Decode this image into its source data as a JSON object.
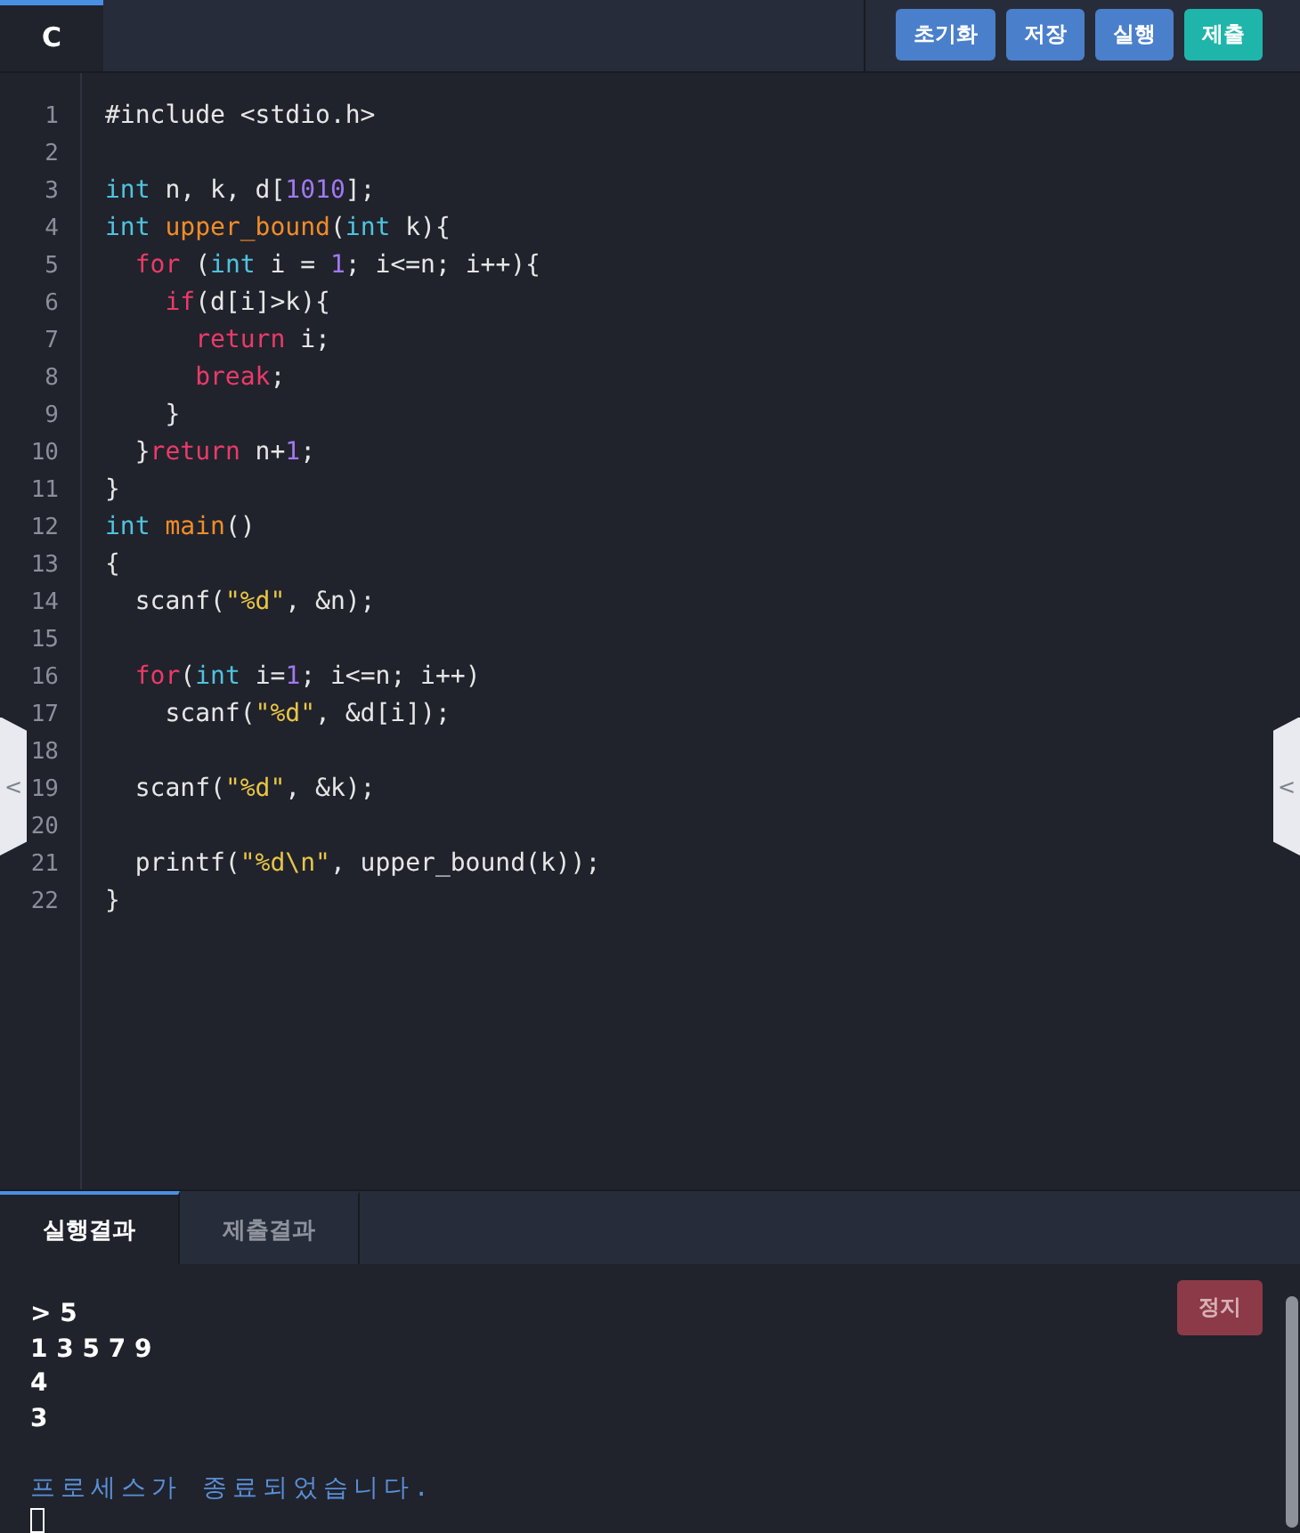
{
  "language_tab": {
    "label": "C",
    "selected": true
  },
  "toolbar": {
    "buttons": [
      {
        "label": "초기화",
        "kind": "primary"
      },
      {
        "label": "저장",
        "kind": "primary"
      },
      {
        "label": "실행",
        "kind": "primary"
      },
      {
        "label": "제출",
        "kind": "submit"
      }
    ]
  },
  "editor": {
    "lines": [
      {
        "number": "1",
        "tokens": [
          {
            "text": "#include <stdio.h>",
            "kind": "plain"
          }
        ]
      },
      {
        "number": "2"
      },
      {
        "number": "3",
        "tokens": [
          {
            "text": "int",
            "kind": "type"
          },
          {
            "text": " n, k, d[",
            "kind": "plain"
          },
          {
            "text": "1010",
            "kind": "number"
          },
          {
            "text": "];",
            "kind": "plain"
          }
        ]
      },
      {
        "number": "4",
        "tokens": [
          {
            "text": "int",
            "kind": "type"
          },
          {
            "text": " upper_bound",
            "kind": "function"
          },
          {
            "text": "(",
            "kind": "plain"
          },
          {
            "text": "int",
            "kind": "type"
          },
          {
            "text": " k){",
            "kind": "plain"
          }
        ]
      },
      {
        "number": "5",
        "tokens": [
          {
            "text": "  for",
            "kind": "keyword"
          },
          {
            "text": " (",
            "kind": "plain"
          },
          {
            "text": "int",
            "kind": "type"
          },
          {
            "text": " i = ",
            "kind": "plain"
          },
          {
            "text": "1",
            "kind": "number"
          },
          {
            "text": "; i<=n; i++){",
            "kind": "plain"
          }
        ]
      },
      {
        "number": "6",
        "tokens": [
          {
            "text": "    if",
            "kind": "keyword"
          },
          {
            "text": "(d[i]>k){",
            "kind": "plain"
          }
        ]
      },
      {
        "number": "7",
        "tokens": [
          {
            "text": "      return",
            "kind": "keyword"
          },
          {
            "text": " i;",
            "kind": "plain"
          }
        ]
      },
      {
        "number": "8",
        "tokens": [
          {
            "text": "      break",
            "kind": "keyword"
          },
          {
            "text": ";",
            "kind": "plain"
          }
        ]
      },
      {
        "number": "9",
        "tokens": [
          {
            "text": "    }",
            "kind": "plain"
          }
        ]
      },
      {
        "number": "10",
        "tokens": [
          {
            "text": "  }",
            "kind": "plain"
          },
          {
            "text": "return",
            "kind": "keyword"
          },
          {
            "text": " n+",
            "kind": "plain"
          },
          {
            "text": "1",
            "kind": "number"
          },
          {
            "text": ";",
            "kind": "plain"
          }
        ]
      },
      {
        "number": "11",
        "tokens": [
          {
            "text": "}",
            "kind": "plain"
          }
        ]
      },
      {
        "number": "12",
        "tokens": [
          {
            "text": "int",
            "kind": "type"
          },
          {
            "text": " main",
            "kind": "function"
          },
          {
            "text": "()",
            "kind": "plain"
          }
        ]
      },
      {
        "number": "13",
        "tokens": [
          {
            "text": "{",
            "kind": "plain"
          }
        ]
      },
      {
        "number": "14",
        "tokens": [
          {
            "text": "  scanf(",
            "kind": "plain"
          },
          {
            "text": "\"%d\"",
            "kind": "string"
          },
          {
            "text": ", &n);",
            "kind": "plain"
          }
        ]
      },
      {
        "number": "15"
      },
      {
        "number": "16",
        "tokens": [
          {
            "text": "  for",
            "kind": "keyword"
          },
          {
            "text": "(",
            "kind": "plain"
          },
          {
            "text": "int",
            "kind": "type"
          },
          {
            "text": " i=",
            "kind": "plain"
          },
          {
            "text": "1",
            "kind": "number"
          },
          {
            "text": "; i<=n; i++)",
            "kind": "plain"
          }
        ]
      },
      {
        "number": "17",
        "tokens": [
          {
            "text": "    scanf(",
            "kind": "plain"
          },
          {
            "text": "\"%d\"",
            "kind": "string"
          },
          {
            "text": ", &d[i]);",
            "kind": "plain"
          }
        ]
      },
      {
        "number": "18"
      },
      {
        "number": "19",
        "tokens": [
          {
            "text": "  scanf(",
            "kind": "plain"
          },
          {
            "text": "\"%d\"",
            "kind": "string"
          },
          {
            "text": ", &k);",
            "kind": "plain"
          }
        ]
      },
      {
        "number": "20"
      },
      {
        "number": "21",
        "tokens": [
          {
            "text": "  printf(",
            "kind": "plain"
          },
          {
            "text": "\"%d\\n\"",
            "kind": "string"
          },
          {
            "text": ", upper_bound(k));",
            "kind": "plain"
          }
        ]
      },
      {
        "number": "22",
        "tokens": [
          {
            "text": "}",
            "kind": "plain"
          }
        ]
      }
    ]
  },
  "left_handle": {
    "label": "<"
  },
  "right_handle": {
    "label": "<"
  },
  "result_tabs": [
    {
      "label": "실행결과",
      "selected": true
    },
    {
      "label": "제출결과",
      "selected": false
    }
  ],
  "output": {
    "stop_button": "정지",
    "stop_disabled": true,
    "lines": [
      "> 5",
      "1 3 5 7 9",
      "4",
      "3"
    ],
    "status": "프로세스가 종료되었습니다."
  }
}
